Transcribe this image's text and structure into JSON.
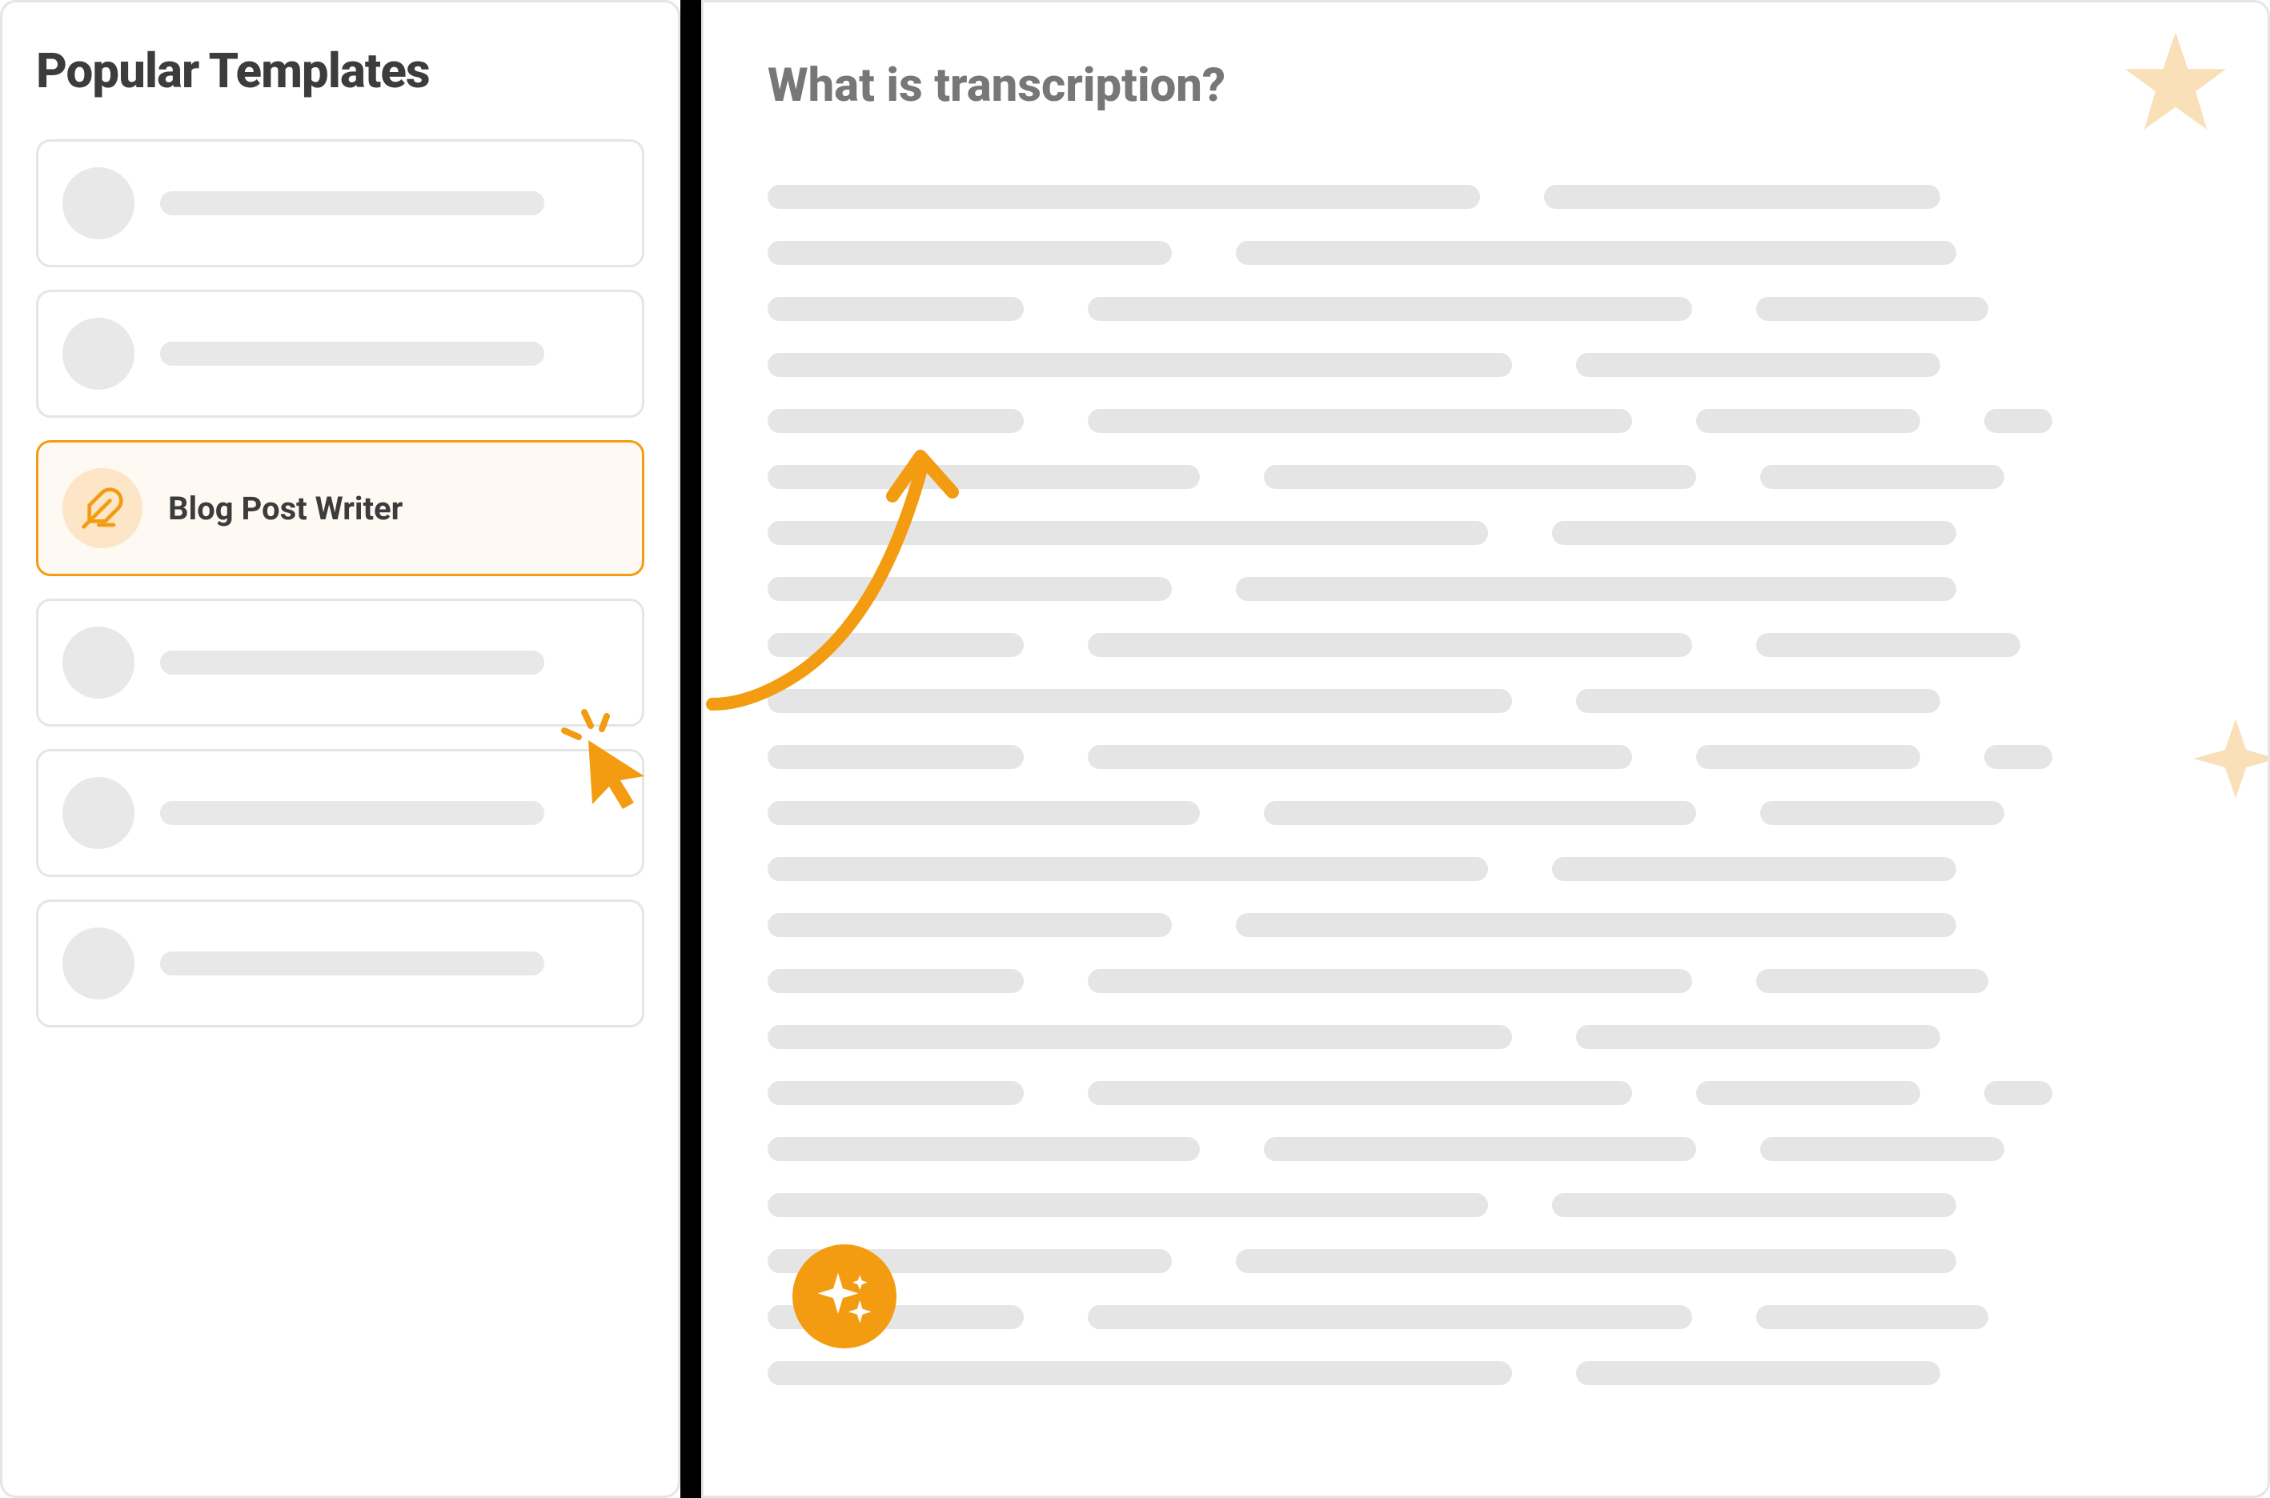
{
  "sidebar": {
    "title": "Popular Templates",
    "templates": [
      {
        "label": "",
        "active": false
      },
      {
        "label": "",
        "active": false
      },
      {
        "label": "Blog Post Writer",
        "active": true
      },
      {
        "label": "",
        "active": false
      },
      {
        "label": "",
        "active": false
      },
      {
        "label": "",
        "active": false
      }
    ]
  },
  "content": {
    "title": "What is transcription?"
  },
  "colors": {
    "accent": "#f39c12",
    "accentLight": "#fde5c8",
    "starLight": "#fae0b8",
    "placeholder": "#e5e5e5",
    "textDark": "#3c3c3c",
    "textMuted": "#777"
  },
  "textRows": [
    [
      890,
      20,
      495
    ],
    [
      505,
      20,
      900
    ],
    [
      320,
      20,
      755,
      20,
      290
    ],
    [
      930,
      20,
      455
    ],
    [
      320,
      20,
      680,
      20,
      280,
      20,
      85
    ],
    [
      540,
      20,
      540,
      20,
      305
    ],
    [
      900,
      20,
      505
    ],
    [
      505,
      20,
      900
    ],
    [
      320,
      20,
      755,
      20,
      330
    ],
    [
      930,
      20,
      455
    ],
    [
      320,
      20,
      680,
      20,
      280,
      20,
      85
    ],
    [
      540,
      20,
      540,
      20,
      305
    ],
    [
      900,
      20,
      505
    ],
    [
      505,
      20,
      900
    ],
    [
      320,
      20,
      755,
      20,
      290
    ],
    [
      930,
      20,
      455
    ],
    [
      320,
      20,
      680,
      20,
      280,
      20,
      85
    ],
    [
      540,
      20,
      540,
      20,
      305
    ],
    [
      900,
      20,
      505
    ],
    [
      505,
      20,
      900
    ],
    [
      320,
      20,
      755,
      20,
      290
    ],
    [
      930,
      20,
      455
    ]
  ]
}
